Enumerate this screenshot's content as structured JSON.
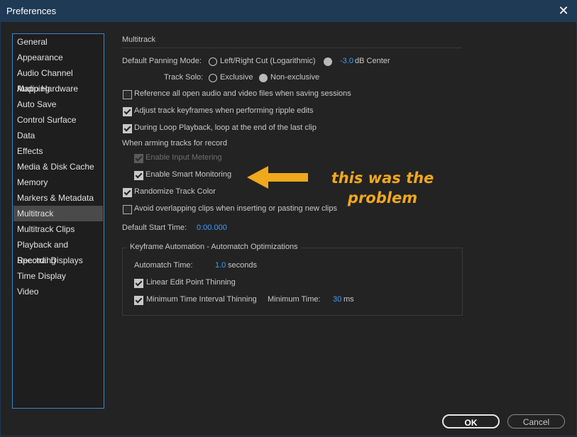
{
  "window": {
    "title": "Preferences"
  },
  "sidebar": {
    "items": [
      {
        "label": "General"
      },
      {
        "label": "Appearance"
      },
      {
        "label": "Audio Channel Mapping"
      },
      {
        "label": "Audio Hardware"
      },
      {
        "label": "Auto Save"
      },
      {
        "label": "Control Surface"
      },
      {
        "label": "Data"
      },
      {
        "label": "Effects"
      },
      {
        "label": "Media & Disk Cache"
      },
      {
        "label": "Memory"
      },
      {
        "label": "Markers & Metadata"
      },
      {
        "label": "Multitrack"
      },
      {
        "label": "Multitrack Clips"
      },
      {
        "label": "Playback and Recording"
      },
      {
        "label": "Spectral Displays"
      },
      {
        "label": "Time Display"
      },
      {
        "label": "Video"
      }
    ],
    "selected": "Multitrack"
  },
  "panel": {
    "section_title": "Multitrack",
    "panning": {
      "label": "Default Panning Mode:",
      "option1": "Left/Right Cut (Logarithmic)",
      "value": "-3.0",
      "option2_suffix": "dB Center",
      "selected": "option2"
    },
    "track_solo": {
      "label": "Track Solo:",
      "option1": "Exclusive",
      "option2": "Non-exclusive",
      "selected": "option2"
    },
    "checks": {
      "reference_files": {
        "label": "Reference all open audio and video files when saving sessions",
        "checked": false
      },
      "adjust_keyframes": {
        "label": "Adjust track keyframes when performing ripple edits",
        "checked": true
      },
      "loop_playback": {
        "label": "During Loop Playback, loop at the end of the last clip",
        "checked": true
      },
      "arming_heading": "When arming tracks for record",
      "input_metering": {
        "label": "Enable Input Metering",
        "checked": true,
        "disabled": true
      },
      "smart_monitoring": {
        "label": "Enable Smart Monitoring",
        "checked": true
      },
      "randomize_color": {
        "label": "Randomize Track Color",
        "checked": true
      },
      "avoid_overlap": {
        "label": "Avoid overlapping clips when inserting or pasting new clips",
        "checked": false
      }
    },
    "default_start_time": {
      "label": "Default Start Time:",
      "value": "0:00.000"
    },
    "automatch": {
      "title": "Keyframe Automation - Automatch Optimizations",
      "time_label": "Automatch Time:",
      "time_value": "1.0",
      "time_unit": "seconds",
      "linear_thinning": {
        "label": "Linear Edit Point Thinning",
        "checked": true
      },
      "min_interval": {
        "label": "Minimum Time Interval Thinning",
        "checked": true
      },
      "min_time_label": "Minimum Time:",
      "min_time_value": "30",
      "min_time_unit": "ms"
    }
  },
  "annotation": {
    "line1": "this was the",
    "line2": "problem",
    "color": "#f0a81c"
  },
  "buttons": {
    "ok": "OK",
    "cancel": "Cancel"
  }
}
